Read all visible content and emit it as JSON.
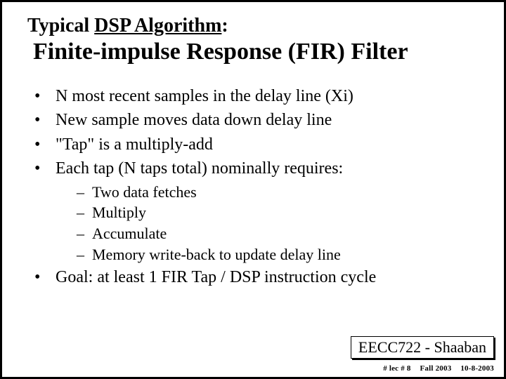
{
  "pretitle_plain": "Typical ",
  "pretitle_underlined": "DSP Algorithm",
  "pretitle_colon": ":",
  "title": "Finite-impulse Response (FIR) Filter",
  "bullets": [
    "N most recent samples in the delay line (Xi)",
    "New sample moves data down delay line",
    "\"Tap\" is a multiply-add",
    "Each tap (N taps total) nominally requires:"
  ],
  "subbullets": [
    "Two data fetches",
    "Multiply",
    "Accumulate",
    "Memory write-back to update delay line"
  ],
  "bullet_goal": "Goal:  at least 1 FIR Tap / DSP instruction cycle",
  "footer_box": "EECC722 - Shaaban",
  "footer_lec": "#  lec # 8",
  "footer_term": "Fall 2003",
  "footer_date": "10-8-2003"
}
